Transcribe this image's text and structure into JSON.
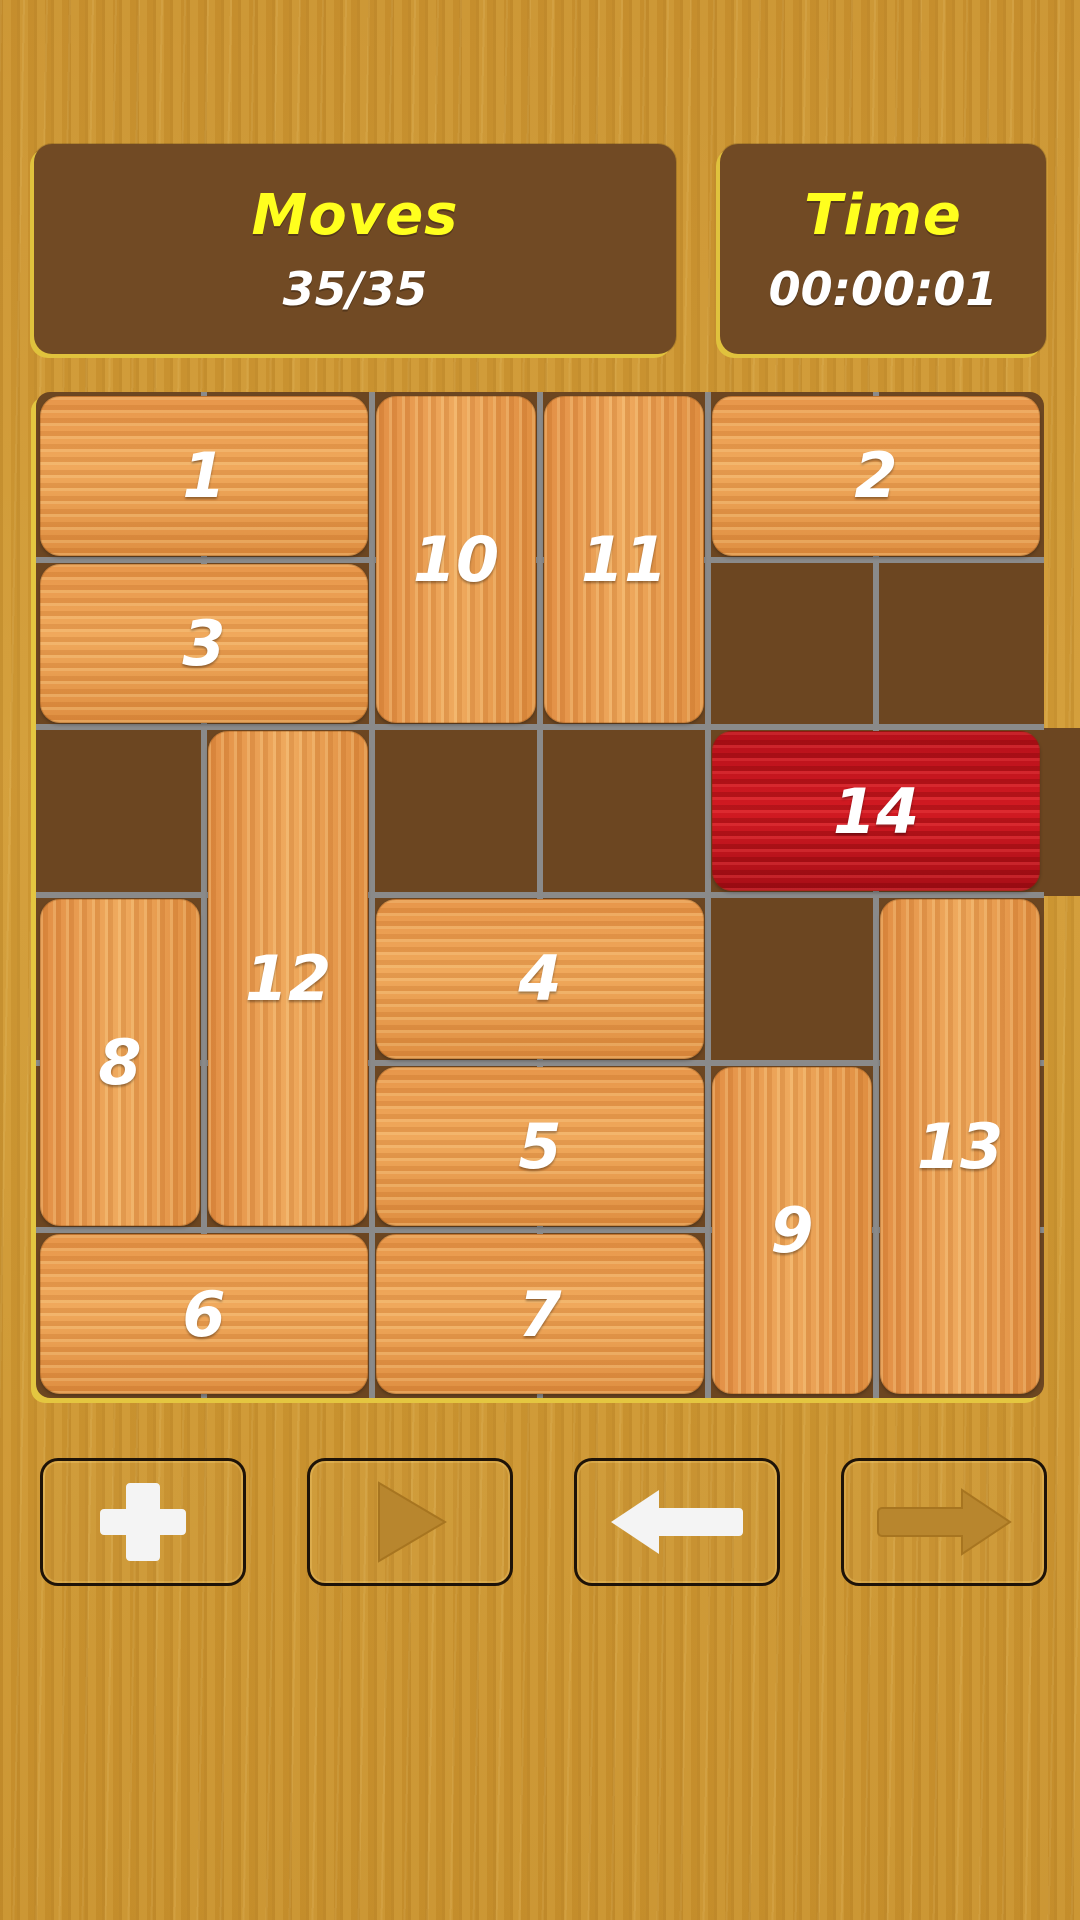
{
  "header": {
    "moves_label": "Moves",
    "moves_value": "35/35",
    "time_label": "Time",
    "time_value": "00:00:01"
  },
  "board": {
    "columns": 6,
    "rows": 6,
    "blocks": [
      {
        "label": "1",
        "col": 0,
        "row": 0,
        "w": 2,
        "h": 1,
        "kind": "h"
      },
      {
        "label": "10",
        "col": 2,
        "row": 0,
        "w": 1,
        "h": 2,
        "kind": "v"
      },
      {
        "label": "11",
        "col": 3,
        "row": 0,
        "w": 1,
        "h": 2,
        "kind": "v"
      },
      {
        "label": "2",
        "col": 4,
        "row": 0,
        "w": 2,
        "h": 1,
        "kind": "h"
      },
      {
        "label": "3",
        "col": 0,
        "row": 1,
        "w": 2,
        "h": 1,
        "kind": "h"
      },
      {
        "label": "12",
        "col": 1,
        "row": 2,
        "w": 1,
        "h": 3,
        "kind": "v"
      },
      {
        "label": "14",
        "col": 4,
        "row": 2,
        "w": 2,
        "h": 1,
        "kind": "target"
      },
      {
        "label": "8",
        "col": 0,
        "row": 3,
        "w": 1,
        "h": 2,
        "kind": "v"
      },
      {
        "label": "4",
        "col": 2,
        "row": 3,
        "w": 2,
        "h": 1,
        "kind": "h"
      },
      {
        "label": "13",
        "col": 5,
        "row": 3,
        "w": 1,
        "h": 3,
        "kind": "v"
      },
      {
        "label": "5",
        "col": 2,
        "row": 4,
        "w": 2,
        "h": 1,
        "kind": "h"
      },
      {
        "label": "9",
        "col": 4,
        "row": 4,
        "w": 1,
        "h": 2,
        "kind": "v"
      },
      {
        "label": "6",
        "col": 0,
        "row": 5,
        "w": 2,
        "h": 1,
        "kind": "h"
      },
      {
        "label": "7",
        "col": 2,
        "row": 5,
        "w": 2,
        "h": 1,
        "kind": "h"
      }
    ]
  },
  "controls": [
    {
      "name": "new-game-button",
      "icon": "plus-icon"
    },
    {
      "name": "play-button",
      "icon": "play-icon"
    },
    {
      "name": "undo-button",
      "icon": "arrow-left-icon"
    },
    {
      "name": "redo-button",
      "icon": "arrow-right-icon"
    }
  ],
  "colors": {
    "panel": "#714a24",
    "label_yellow": "#ffff1e",
    "board": "#6c4621",
    "target_block": "#c8141d"
  }
}
